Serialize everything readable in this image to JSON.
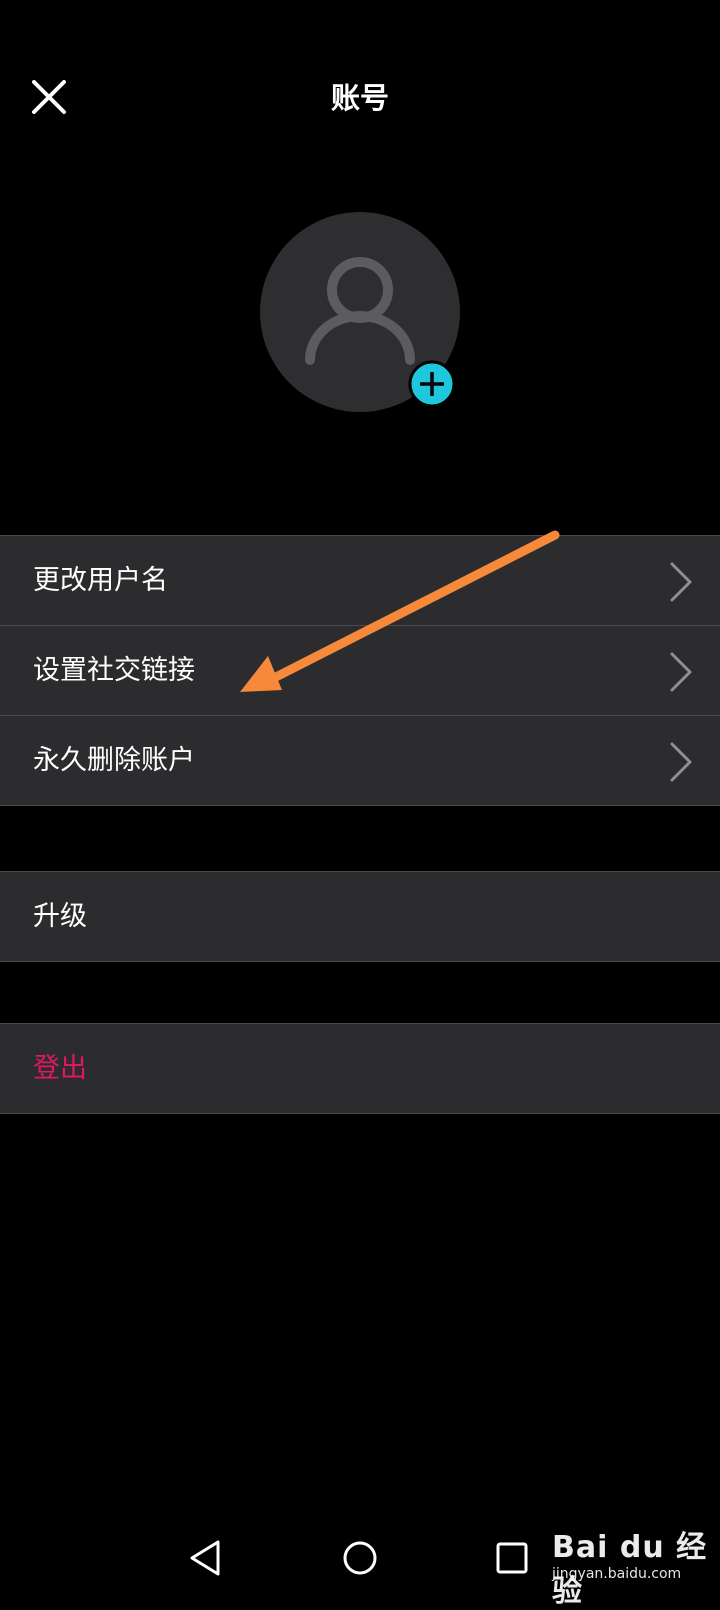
{
  "header": {
    "title": "账号",
    "close_icon": "close-icon"
  },
  "avatar": {
    "icon": "user-icon",
    "add_icon": "plus-icon",
    "add_color": "#1ec8dc"
  },
  "menu": {
    "items": [
      {
        "label": "更改用户名",
        "icon": "chevron-right-icon"
      },
      {
        "label": "设置社交链接",
        "icon": "chevron-right-icon"
      },
      {
        "label": "永久删除账户",
        "icon": "chevron-right-icon"
      }
    ]
  },
  "upgrade": {
    "label": "升级"
  },
  "logout": {
    "label": "登出",
    "color": "#e0195f"
  },
  "annotation": {
    "arrow_color": "#f68a3a"
  },
  "navbar": {
    "back_icon": "triangle-back-icon",
    "home_icon": "circle-home-icon",
    "recents_icon": "square-recents-icon"
  },
  "watermark": {
    "brand": "Bai du 经验",
    "url": "jingyan.baidu.com"
  }
}
